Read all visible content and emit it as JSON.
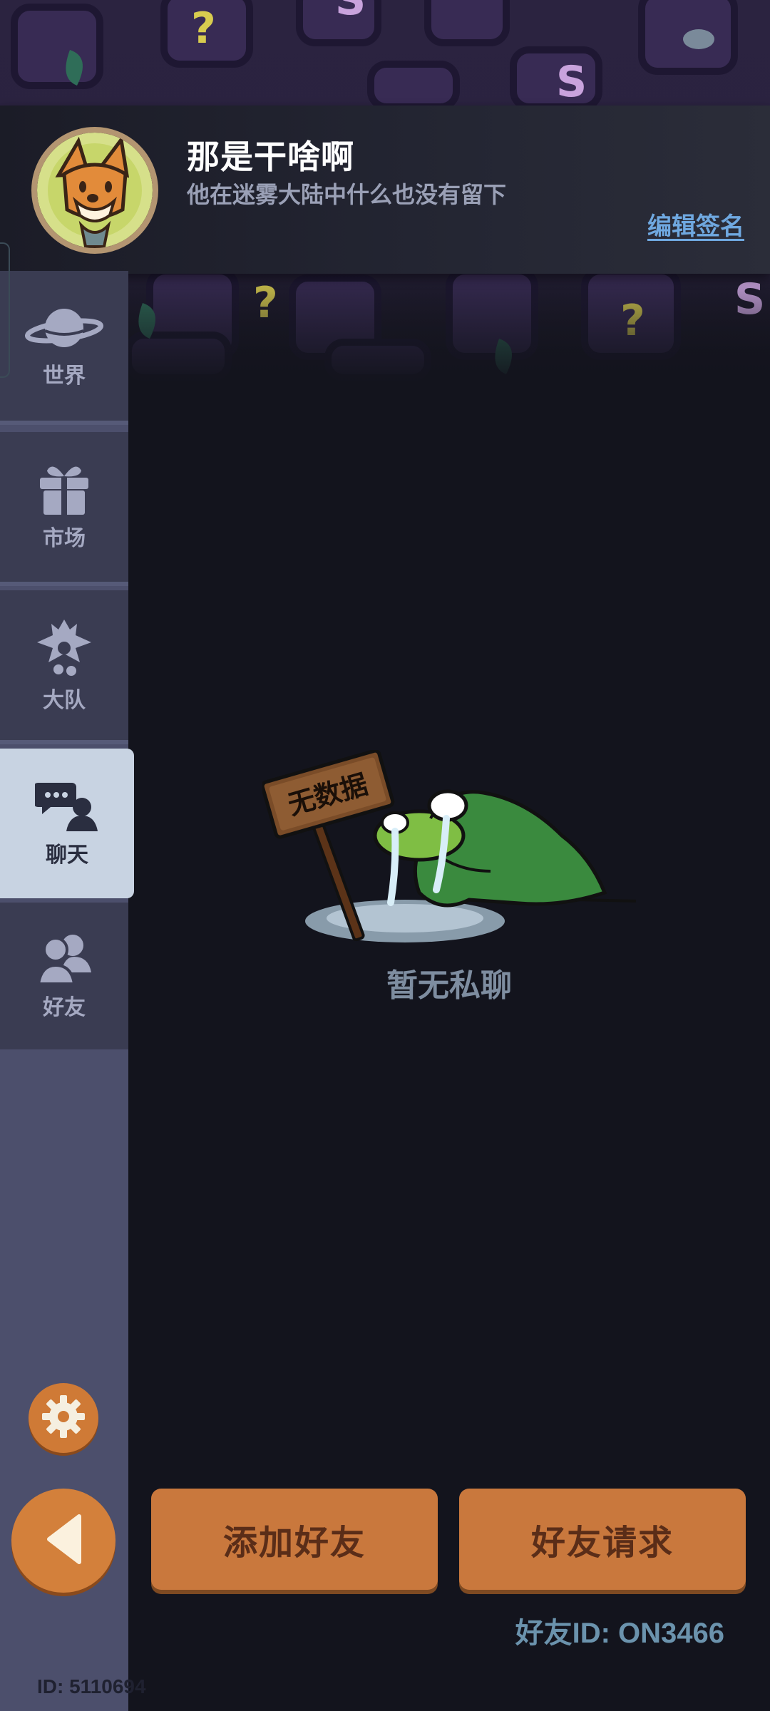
{
  "profile": {
    "name": "那是干啥啊",
    "signature": "他在迷雾大陆中什么也没有留下",
    "edit_signature_label": "编辑签名"
  },
  "sidebar": {
    "items": [
      {
        "label": "世界",
        "icon": "planet-icon"
      },
      {
        "label": "市场",
        "icon": "gift-icon"
      },
      {
        "label": "大队",
        "icon": "guild-emblem-icon"
      },
      {
        "label": "聊天",
        "icon": "chat-bubbles-icon",
        "active": true
      },
      {
        "label": "好友",
        "icon": "friends-icon"
      }
    ],
    "settings_icon": "gear-icon",
    "back_icon": "back-arrow-icon"
  },
  "empty_state": {
    "sign_text": "无数据",
    "message": "暂无私聊"
  },
  "actions": {
    "add_friend_label": "添加好友",
    "friend_requests_label": "好友请求"
  },
  "friend_id_text": "好友ID: ON3466",
  "user_id_text": "ID: 5110694",
  "colors": {
    "accent_orange": "#c9783d",
    "active_tab": "#c8d3e2",
    "sidebar": "#3a3c52",
    "background": "#13141d",
    "link_blue": "#6fa8e0"
  }
}
